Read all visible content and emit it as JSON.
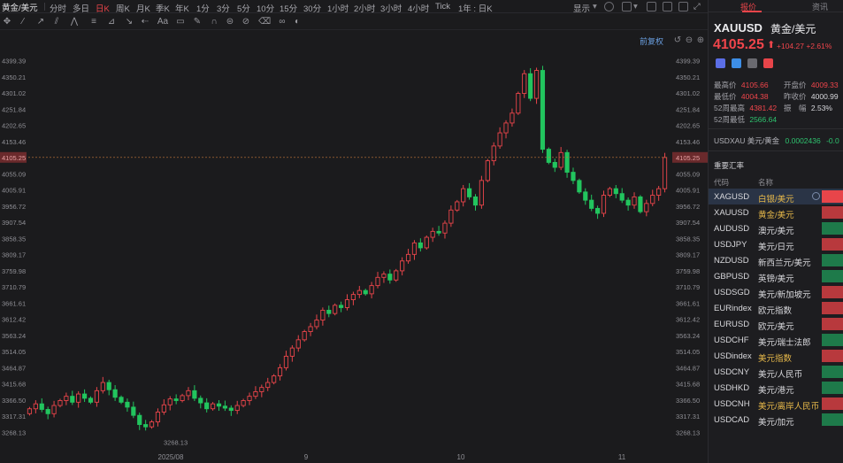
{
  "topbar": {
    "symbol_tab": "黄金/美元",
    "timeframes": [
      "分时",
      "多日",
      "日K",
      "周K",
      "月K",
      "季K",
      "年K",
      "1分",
      "3分",
      "5分",
      "10分",
      "15分",
      "30分",
      "1小时",
      "2小时",
      "3小时",
      "4小时",
      "Tick",
      "1年 : 日K"
    ],
    "active_timeframe": "日K",
    "display_label": "显示"
  },
  "chart": {
    "fuquan_label": "前复权",
    "ref_price_label": "4105.25",
    "right_ref_label": "4105.25"
  },
  "panel": {
    "tabs": [
      "报价",
      "资讯"
    ],
    "active_tab": "报价",
    "symbol": "XAUUSD",
    "name": "黄金/美元",
    "price": "4105.25",
    "arrow": "⬆",
    "change": "+104.27",
    "change_pct": "+2.61%",
    "stats": {
      "high_label": "最高价",
      "high": "4105.66",
      "open_label": "开盘价",
      "open": "4009.33",
      "low_label": "最低价",
      "low": "4004.38",
      "prev_label": "昨收价",
      "prev": "4000.99",
      "w52h_label": "52周最高",
      "w52h": "4381.42",
      "amp_label": "振　幅",
      "amp": "2.53%",
      "w52l_label": "52周最低",
      "w52l": "2566.64"
    },
    "usdxau": {
      "label": "USDXAU 美元/黄金",
      "value": "0.0002436",
      "change": "-0.0"
    },
    "section_title": "重要汇率",
    "list_headers": {
      "code": "代码",
      "name": "名称"
    },
    "rows": [
      {
        "code": "XAGUSD",
        "name": "白银/美元",
        "gold": true,
        "color": "#e8454a"
      },
      {
        "code": "XAUUSD",
        "name": "黄金/美元",
        "gold": true,
        "color": "#b8393d"
      },
      {
        "code": "AUDUSD",
        "name": "澳元/美元",
        "gold": false,
        "color": "#1e7a4a"
      },
      {
        "code": "USDJPY",
        "name": "美元/日元",
        "gold": false,
        "color": "#b8393d"
      },
      {
        "code": "NZDUSD",
        "name": "新西兰元/美元",
        "gold": false,
        "color": "#1e7a4a"
      },
      {
        "code": "GBPUSD",
        "name": "英镑/美元",
        "gold": false,
        "color": "#1e7a4a"
      },
      {
        "code": "USDSGD",
        "name": "美元/新加坡元",
        "gold": false,
        "color": "#b8393d"
      },
      {
        "code": "EURindex",
        "name": "欧元指数",
        "gold": false,
        "color": "#b8393d"
      },
      {
        "code": "EURUSD",
        "name": "欧元/美元",
        "gold": false,
        "color": "#b8393d"
      },
      {
        "code": "USDCHF",
        "name": "美元/瑞士法郎",
        "gold": false,
        "color": "#1e7a4a"
      },
      {
        "code": "USDindex",
        "name": "美元指数",
        "gold": true,
        "color": "#b8393d"
      },
      {
        "code": "USDCNY",
        "name": "美元/人民币",
        "gold": false,
        "color": "#1e7a4a"
      },
      {
        "code": "USDHKD",
        "name": "美元/港元",
        "gold": false,
        "color": "#1e7a4a"
      },
      {
        "code": "USDCNH",
        "name": "美元/离岸人民币",
        "gold": true,
        "color": "#b8393d"
      },
      {
        "code": "USDCAD",
        "name": "美元/加元",
        "gold": false,
        "color": "#1e7a4a"
      }
    ]
  },
  "chart_data": {
    "type": "candlestick",
    "y_ticks": [
      "4399.39",
      "4350.21",
      "4301.02",
      "4251.84",
      "4202.65",
      "4153.46",
      "4105.25",
      "4055.09",
      "4005.91",
      "3956.72",
      "3907.54",
      "3858.35",
      "3809.17",
      "3759.98",
      "3710.79",
      "3661.61",
      "3612.42",
      "3563.24",
      "3514.05",
      "3464.87",
      "3415.68",
      "3366.50",
      "3317.31",
      "3268.13"
    ],
    "right_ticks": [
      "4399.39",
      "4350.21",
      "4301.02",
      "4251.84",
      "4202.65",
      "4153.46",
      "4105.25",
      "4055.09",
      "4005.91",
      "3956.72",
      "3907.54",
      "3858.35",
      "3809.17",
      "3759.98",
      "3710.79",
      "3661.61",
      "3612.42",
      "3563.24",
      "3514.05",
      "3464.87",
      "3415.68",
      "3366.50",
      "3317.31",
      "3268.13"
    ],
    "x_labels": [
      "2025/08",
      "9",
      "10",
      "11"
    ],
    "low_annotation": "3268.13",
    "ylim": [
      3245,
      4420
    ],
    "up_color": "#e8454a",
    "down_color": "#22c55e",
    "closes": [
      3340,
      3355,
      3338,
      3325,
      3350,
      3365,
      3378,
      3360,
      3385,
      3372,
      3360,
      3395,
      3420,
      3398,
      3375,
      3360,
      3345,
      3320,
      3292,
      3285,
      3300,
      3330,
      3352,
      3370,
      3365,
      3380,
      3395,
      3372,
      3358,
      3340,
      3355,
      3348,
      3342,
      3335,
      3350,
      3365,
      3378,
      3392,
      3405,
      3420,
      3440,
      3465,
      3500,
      3525,
      3550,
      3575,
      3590,
      3610,
      3640,
      3630,
      3655,
      3648,
      3672,
      3688,
      3700,
      3690,
      3715,
      3740,
      3750,
      3732,
      3760,
      3790,
      3810,
      3845,
      3830,
      3862,
      3880,
      3875,
      3905,
      3945,
      3970,
      4010,
      3985,
      3960,
      4035,
      4095,
      4140,
      4180,
      4210,
      4240,
      4300,
      4360,
      4285,
      4370,
      4130,
      4090,
      4075,
      4120,
      4060,
      4035,
      4000,
      3975,
      3950,
      3935,
      3990,
      4010,
      3995,
      3975,
      3960,
      3985,
      3940,
      3965,
      3990,
      4010,
      4105
    ],
    "opens": [
      3325,
      3340,
      3355,
      3338,
      3325,
      3350,
      3365,
      3378,
      3360,
      3385,
      3372,
      3360,
      3395,
      3420,
      3398,
      3375,
      3360,
      3345,
      3320,
      3292,
      3285,
      3300,
      3330,
      3352,
      3370,
      3365,
      3380,
      3395,
      3372,
      3358,
      3340,
      3355,
      3348,
      3342,
      3335,
      3350,
      3365,
      3378,
      3392,
      3405,
      3420,
      3440,
      3465,
      3500,
      3525,
      3550,
      3575,
      3590,
      3610,
      3640,
      3630,
      3655,
      3648,
      3672,
      3688,
      3700,
      3690,
      3715,
      3740,
      3750,
      3732,
      3760,
      3790,
      3810,
      3845,
      3830,
      3862,
      3880,
      3875,
      3905,
      3945,
      3970,
      4010,
      3985,
      3960,
      4035,
      4095,
      4140,
      4180,
      4210,
      4240,
      4300,
      4360,
      4285,
      4370,
      4130,
      4090,
      4075,
      4120,
      4060,
      4035,
      4000,
      3975,
      3950,
      3935,
      3990,
      4010,
      3995,
      3975,
      3960,
      3985,
      3940,
      3965,
      3990,
      4010
    ],
    "highs_pad": 14,
    "lows_pad": 14
  }
}
